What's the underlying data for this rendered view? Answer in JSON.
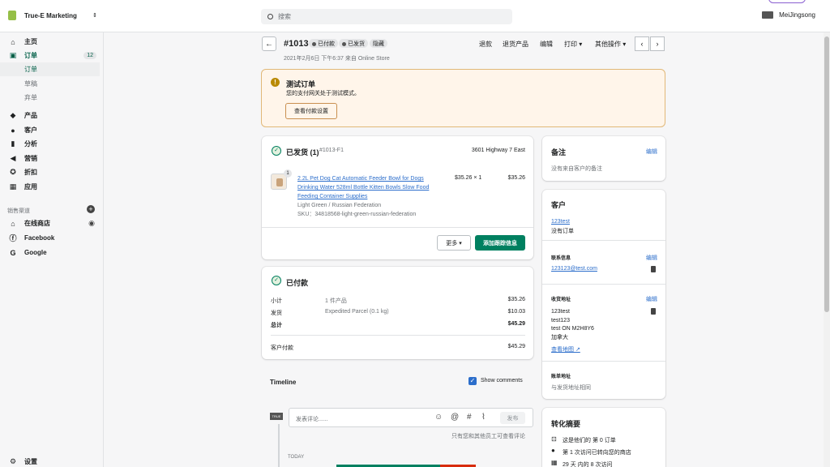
{
  "topbar": {
    "store_name": "True-E Marketing",
    "search_placeholder": "搜索",
    "user_name": "MeiJingsong"
  },
  "sidebar": {
    "items": [
      {
        "label": "主页",
        "icon": "home-icon"
      },
      {
        "label": "订单",
        "icon": "orders-icon",
        "badge": "12"
      },
      {
        "label": "订单"
      },
      {
        "label": "草稿"
      },
      {
        "label": "弃单"
      },
      {
        "label": "产品",
        "icon": "tag-icon"
      },
      {
        "label": "客户",
        "icon": "customer-icon"
      },
      {
        "label": "分析",
        "icon": "analytics-icon"
      },
      {
        "label": "营销",
        "icon": "megaphone-icon"
      },
      {
        "label": "折扣",
        "icon": "discount-icon"
      },
      {
        "label": "应用",
        "icon": "apps-icon"
      }
    ],
    "channels_label": "销售渠道",
    "channels": [
      {
        "label": "在线商店",
        "icon": "store-icon"
      },
      {
        "label": "Facebook",
        "icon": "facebook-icon"
      },
      {
        "label": "Google",
        "icon": "google-icon"
      }
    ],
    "settings_label": "设置"
  },
  "header": {
    "order_number": "#1013",
    "status_paid": "已付款",
    "status_shipped": "已发货",
    "status_hidden": "隐藏",
    "date": "2021年2月6日 下午6:37 来自 Online Store",
    "actions": [
      "退款",
      "退货产品",
      "编辑",
      "打印 ▾",
      "其他操作 ▾"
    ]
  },
  "banner": {
    "title": "测试订单",
    "text": "您的支付网关处于测试模式。",
    "button": "查看付款设置"
  },
  "fulfillment": {
    "title": "已发货 (1)",
    "fulfillment_id": "#1013-F1",
    "location": "3601 Highway 7 East",
    "item_qty_badge": "1",
    "product_line1": "2.2L Pet Dog Cat Automatic Feeder Bowl for Dogs",
    "product_line2": "Drinking Water 528ml Bottle Kitten Bowls Slow Food",
    "product_line3": "Feeding Container Supplies",
    "variant": "Light Green / Russian Federation",
    "sku": "SKU：34818568-light-green-russian-federation",
    "price_qty": "$35.26 × 1",
    "line_total": "$35.26",
    "more_button": "更多 ▾",
    "tracking_button": "添加跟踪信息"
  },
  "payment": {
    "title": "已付款",
    "rows": [
      {
        "label": "小计",
        "desc": "1 件产品",
        "amount": "$35.26"
      },
      {
        "label": "发货",
        "desc": "Expedited Parcel (0.1 kg)",
        "amount": "$10.03"
      },
      {
        "label": "总计",
        "desc": "",
        "amount": "$45.29"
      }
    ],
    "customer_paid_label": "客户付款",
    "customer_paid_amount": "$45.29"
  },
  "timeline": {
    "label": "Timeline",
    "show_comments": "Show comments",
    "comment_placeholder": "发表评论......",
    "post_button": "发布",
    "note": "只有您和其他员工可查看评论",
    "today": "TODAY",
    "logo_text": "TRUE"
  },
  "notes_card": {
    "title": "备注",
    "edit": "编辑",
    "text": "没有来自客户的备注"
  },
  "customer_card": {
    "title": "客户",
    "name": "123test",
    "orders": "没有订单",
    "contact_title": "联系信息",
    "contact_edit": "编辑",
    "email": "123123@test.com",
    "shipping_title": "收货地址",
    "shipping_edit": "编辑",
    "address": [
      "123test",
      "test123",
      "test ON M2H8Y6",
      "加拿大"
    ],
    "map_link": "查看地图 ↗",
    "billing_title": "账单地址",
    "billing_text": "与发货地址相同"
  },
  "conversion_card": {
    "title": "转化摘要",
    "lines": [
      "这是他们的 第 0 订单",
      "第 1 次访问已转向您的商店",
      "29 天 内的 8 次访问"
    ]
  }
}
